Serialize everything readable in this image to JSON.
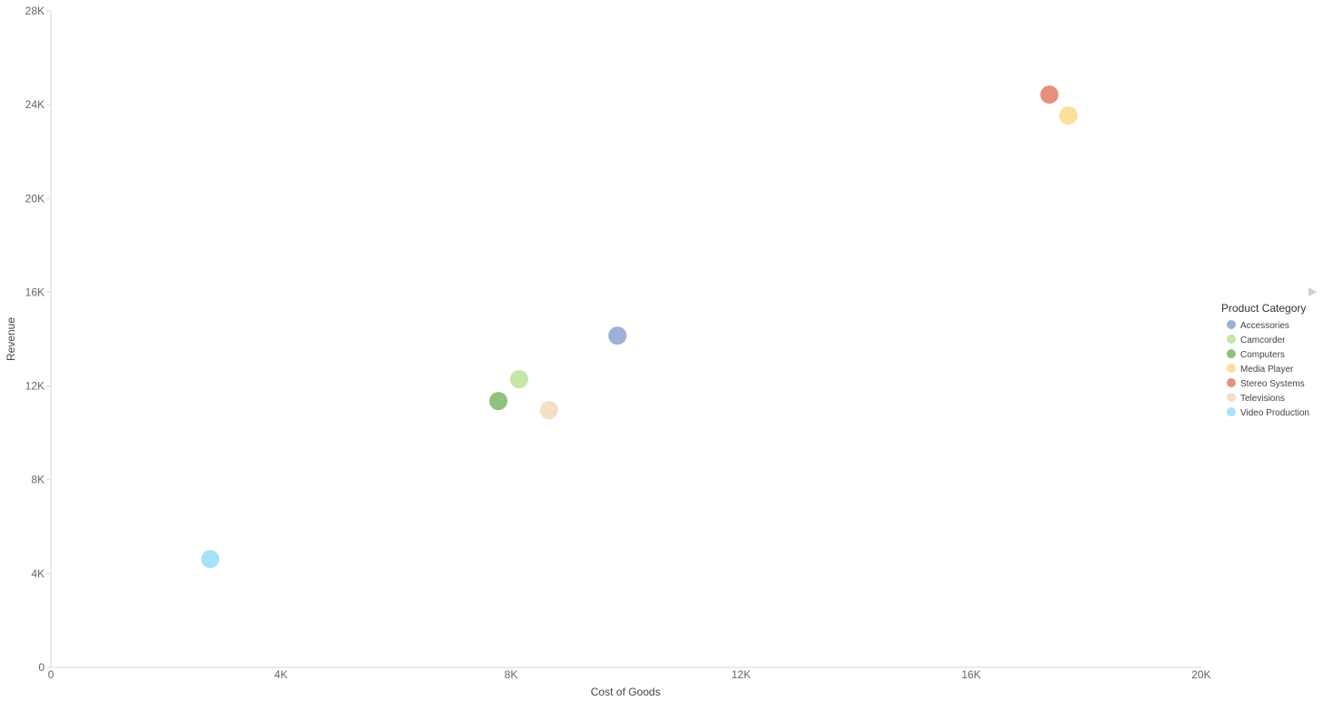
{
  "chart_data": {
    "type": "scatter",
    "title": "",
    "xlabel": "Cost of Goods",
    "ylabel": "Revenue",
    "xlim": [
      0,
      20000
    ],
    "ylim": [
      0,
      28000
    ],
    "xticks": [
      0,
      4000,
      8000,
      12000,
      16000,
      20000
    ],
    "xtick_labels": [
      "0",
      "4K",
      "8K",
      "12K",
      "16K",
      "20K"
    ],
    "yticks": [
      0,
      4000,
      8000,
      12000,
      16000,
      20000,
      24000,
      28000
    ],
    "ytick_labels": [
      "0",
      "4K",
      "8K",
      "12K",
      "16K",
      "20K",
      "24K",
      "28K"
    ],
    "grid": false,
    "legend": {
      "title": "Product Category",
      "position": "right"
    },
    "series": [
      {
        "name": "Accessories",
        "color": "#9bb2d6",
        "points": [
          {
            "x": 9850,
            "y": 14150
          }
        ]
      },
      {
        "name": "Camcorder",
        "color": "#c6e5a8",
        "points": [
          {
            "x": 8140,
            "y": 12290
          }
        ]
      },
      {
        "name": "Computers",
        "color": "#8fc27c",
        "points": [
          {
            "x": 7780,
            "y": 11360
          }
        ]
      },
      {
        "name": "Media Player",
        "color": "#fbe09a",
        "points": [
          {
            "x": 17690,
            "y": 23540
          }
        ]
      },
      {
        "name": "Stereo Systems",
        "color": "#e8907f",
        "points": [
          {
            "x": 17360,
            "y": 24430
          }
        ]
      },
      {
        "name": "Televisions",
        "color": "#f2dfc4",
        "points": [
          {
            "x": 8660,
            "y": 10970
          }
        ]
      },
      {
        "name": "Video Production",
        "color": "#a8e2f9",
        "points": [
          {
            "x": 2770,
            "y": 4620
          }
        ]
      }
    ]
  },
  "legend_expand_icon": "triangle-right-icon"
}
